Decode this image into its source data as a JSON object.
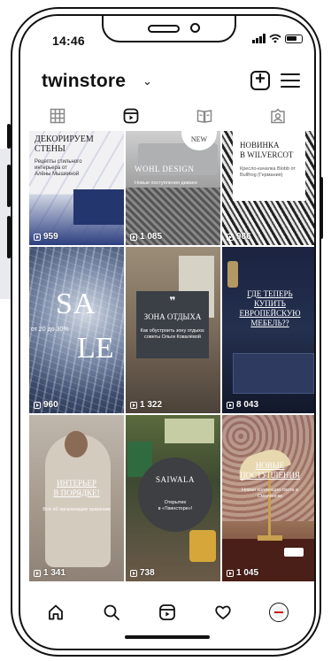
{
  "status": {
    "time": "14:46"
  },
  "header": {
    "username": "twinstore",
    "chevron": "⌄"
  },
  "tabs": [
    {
      "icon": "grid-icon"
    },
    {
      "icon": "reels-icon"
    },
    {
      "icon": "guide-icon"
    },
    {
      "icon": "tagged-icon"
    }
  ],
  "posts": [
    {
      "title": "ДЕКОРИРУЕМ\nСТЕНЫ",
      "subtitle": "Рецепты стильного интерьера от Алёны Мышкиной",
      "views": "959"
    },
    {
      "badge": "NEW",
      "title": "WOHL DESIGN",
      "subtitle": "Новые поступления дивано",
      "views": "1 085"
    },
    {
      "title": "НОВИНКА\nВ WILVERCOT",
      "subtitle": "Кресло-качалка Blobb от Bullfrog (Германия)",
      "views": "986"
    },
    {
      "title_top": "SA",
      "title_bottom": "LE",
      "subtitle": "от 20 до 30%",
      "views": "960"
    },
    {
      "quote": "❞",
      "title": "ЗОНА ОТДЫХА",
      "subtitle": "Как обустроить зону отдыха: советы Ольги Ковалёвой",
      "views": "1 322"
    },
    {
      "title": "ГДЕ ТЕПЕРЬ\nКУПИТЬ\nЕВРОПЕЙСКУЮ\nМЕБЕЛЬ??",
      "views": "8 043"
    },
    {
      "title": "ИНТЕРЬЕР\nВ ПОРЯДКЕ!",
      "subtitle": "Всё об организации хранения",
      "views": "1 341"
    },
    {
      "title": "SAIWALA",
      "subtitle": "Открытие\nв «Твинсторе»!",
      "views": "738"
    },
    {
      "title": "НОВЫЕ\nПОСТУПЛЕНИЯ",
      "subtitle": "Новая коллекция света в Смоленске",
      "views": "1 045"
    }
  ],
  "bottom_nav": [
    {
      "icon": "home-icon"
    },
    {
      "icon": "search-icon"
    },
    {
      "icon": "reels-icon"
    },
    {
      "icon": "heart-icon"
    },
    {
      "icon": "profile-avatar"
    }
  ]
}
